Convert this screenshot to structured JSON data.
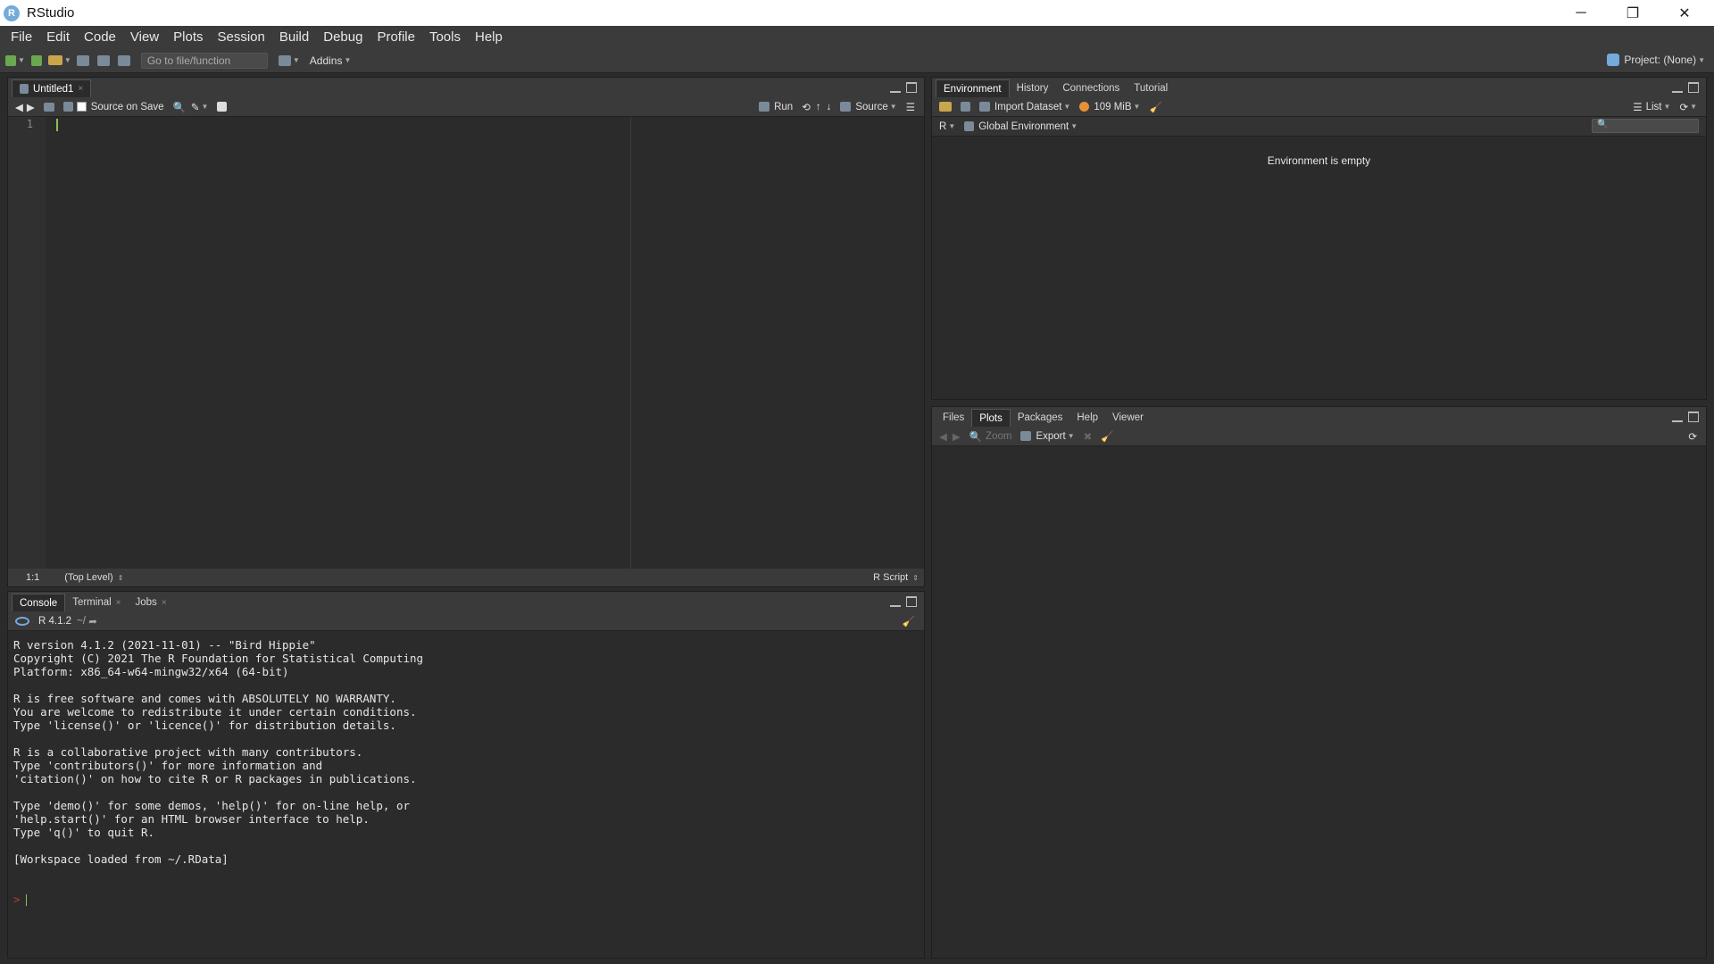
{
  "window": {
    "title": "RStudio",
    "app_letter": "R",
    "controls": [
      "─",
      "❐",
      "✕"
    ]
  },
  "menu": [
    "File",
    "Edit",
    "Code",
    "View",
    "Plots",
    "Session",
    "Build",
    "Debug",
    "Profile",
    "Tools",
    "Help"
  ],
  "toolbar": {
    "goto_placeholder": "Go to file/function",
    "addins_label": "Addins",
    "project_label": "Project: (None)"
  },
  "editor": {
    "tab": "Untitled1",
    "source_on_save": "Source on Save",
    "run_label": "Run",
    "source_label": "Source",
    "line_number": "1",
    "status_position": "1:1",
    "status_scope": "(Top Level)",
    "status_filetype": "R Script"
  },
  "console": {
    "tabs": [
      "Console",
      "Terminal",
      "Jobs"
    ],
    "r_version": "R 4.1.2",
    "path": "~/",
    "text": "R version 4.1.2 (2021-11-01) -- \"Bird Hippie\"\nCopyright (C) 2021 The R Foundation for Statistical Computing\nPlatform: x86_64-w64-mingw32/x64 (64-bit)\n\nR is free software and comes with ABSOLUTELY NO WARRANTY.\nYou are welcome to redistribute it under certain conditions.\nType 'license()' or 'licence()' for distribution details.\n\nR is a collaborative project with many contributors.\nType 'contributors()' for more information and\n'citation()' on how to cite R or R packages in publications.\n\nType 'demo()' for some demos, 'help()' for on-line help, or\n'help.start()' for an HTML browser interface to help.\nType 'q()' to quit R.\n\n[Workspace loaded from ~/.RData]",
    "prompt": ">"
  },
  "environment": {
    "tabs": [
      "Environment",
      "History",
      "Connections",
      "Tutorial"
    ],
    "import_dataset": "Import Dataset",
    "memory": "109 MiB",
    "list_label": "List",
    "lang": "R",
    "scope": "Global Environment",
    "empty_message": "Environment is empty"
  },
  "files": {
    "tabs": [
      "Files",
      "Plots",
      "Packages",
      "Help",
      "Viewer"
    ],
    "zoom_label": "Zoom",
    "export_label": "Export"
  },
  "colors": {
    "accent": "#75aadb",
    "cursor": "#88c057",
    "prompt": "#c0392b"
  }
}
